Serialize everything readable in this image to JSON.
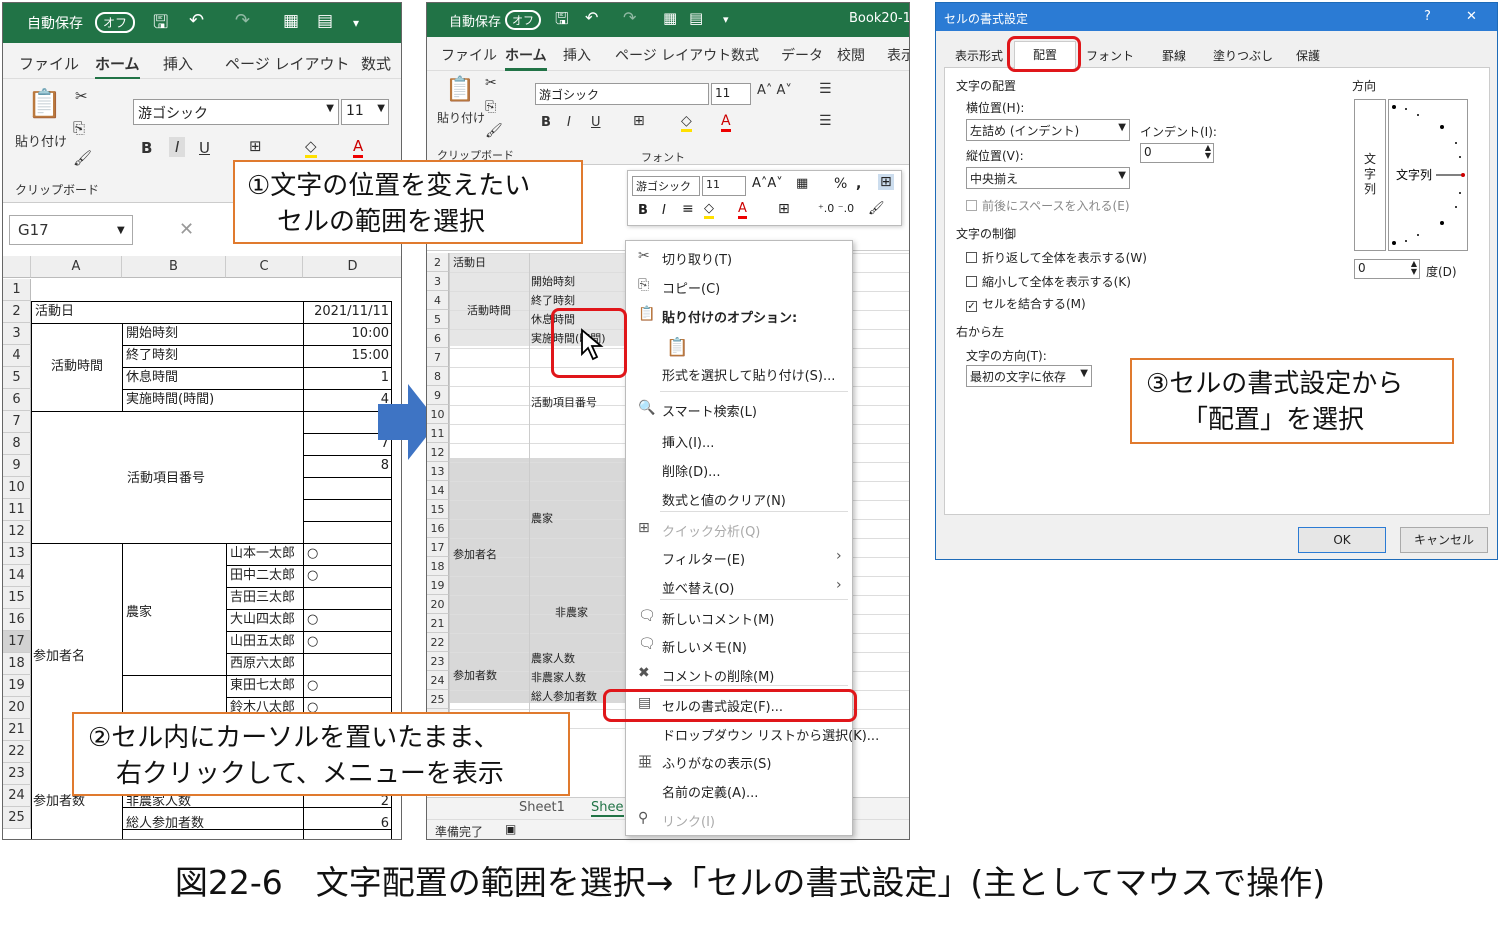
{
  "left_window": {
    "autosave": "自動保存",
    "toggle": "オフ",
    "menu": [
      "ファイル",
      "ホーム",
      "挿入",
      "ページ レイアウト",
      "数式"
    ],
    "paste": "貼り付け",
    "font_name": "游ゴシック",
    "font_size": "11",
    "bold": "B",
    "italic": "I",
    "underline": "U",
    "clipboard_group": "クリップボード",
    "name_box": "G17",
    "columns": [
      "A",
      "B",
      "C",
      "D"
    ],
    "rows": [
      "1",
      "2",
      "3",
      "4",
      "5",
      "6",
      "7",
      "8",
      "9",
      "10",
      "11",
      "12",
      "13",
      "14",
      "15",
      "16",
      "17",
      "18",
      "19",
      "20",
      "21",
      "22",
      "23",
      "24",
      "25"
    ],
    "cells": {
      "activity_day": "活動日",
      "date": "2021/11/11",
      "start": "開始時刻",
      "start_val": "10:00",
      "end": "終了時刻",
      "end_val": "15:00",
      "rest": "休息時間",
      "rest_val": "1",
      "duration": "実施時間(時間)",
      "duration_val": "4",
      "activity_time": "活動時間",
      "activity_item": "活動項目番号",
      "v7": "7",
      "v8": "8",
      "participants": "参加者名",
      "farmer": "農家",
      "names": [
        "山本一太郎",
        "田中二太郎",
        "吉田三太郎",
        "大山四太郎",
        "山田五太郎",
        "西原六太郎",
        "東田七太郎",
        "鈴木八太郎"
      ],
      "marks": [
        "○",
        "○",
        "",
        "○",
        "○",
        "",
        "○",
        "○"
      ],
      "participant_count": "参加者数",
      "non_farmer_count": "非農家人数",
      "non_farmer_val": "2",
      "total": "総人参加者数",
      "total_val": "6"
    }
  },
  "middle_window": {
    "autosave": "自動保存",
    "toggle": "オフ",
    "book": "Book20-1",
    "menu": [
      "ファイル",
      "ホーム",
      "挿入",
      "ページ レイアウト",
      "数式",
      "データ",
      "校閲",
      "表示"
    ],
    "font_name": "游ゴシック",
    "font_size": "11",
    "paste": "貼り付け",
    "clipboard_group": "クリップボード",
    "font_group": "フォント",
    "rows": [
      "2",
      "3",
      "4",
      "5",
      "6",
      "7",
      "8",
      "9",
      "10",
      "11",
      "12",
      "13",
      "14",
      "15",
      "16",
      "17",
      "18",
      "19",
      "20",
      "21",
      "22",
      "23",
      "24",
      "25",
      "26"
    ],
    "cells": {
      "activity_day": "活動日",
      "start": "開始時刻",
      "end": "終了時刻",
      "rest": "休息時間",
      "duration": "実施時間(時間)",
      "activity_time": "活動時間",
      "activity_item": "活動項目番号",
      "farmer": "農家",
      "non_farmer": "非農家",
      "participants": "参加者名",
      "participant_count": "参加者数",
      "farmer_count": "農家人数",
      "non_farmer_count": "非農家人数",
      "total": "総人参加者数"
    },
    "sheets": [
      "Sheet1",
      "Shee"
    ],
    "status": "準備完了"
  },
  "mini_toolbar": {
    "font_name": "游ゴシック",
    "font_size": "11"
  },
  "context_menu": [
    "切り取り(T)",
    "コピー(C)",
    "貼り付けのオプション:",
    "形式を選択して貼り付け(S)...",
    "スマート検索(L)",
    "挿入(I)...",
    "削除(D)...",
    "数式と値のクリア(N)",
    "クイック分析(Q)",
    "フィルター(E)",
    "並べ替え(O)",
    "新しいコメント(M)",
    "新しいメモ(N)",
    "コメントの削除(M)",
    "セルの書式設定(F)...",
    "ドロップダウン リストから選択(K)...",
    "ふりがなの表示(S)",
    "名前の定義(A)...",
    "リンク(I)"
  ],
  "dialog": {
    "title": "セルの書式設定",
    "help": "?",
    "close": "✕",
    "tabs": [
      "表示形式",
      "配置",
      "フォント",
      "罫線",
      "塗りつぶし",
      "保護"
    ],
    "text_alignment": "文字の配置",
    "horizontal_label": "横位置(H):",
    "horizontal_value": "左詰め (インデント)",
    "indent_label": "インデント(I):",
    "indent_value": "0",
    "vertical_label": "縦位置(V):",
    "vertical_value": "中央揃え",
    "justify_distributed": "前後にスペースを入れる(E)",
    "text_control": "文字の制御",
    "wrap": "折り返して全体を表示する(W)",
    "shrink": "縮小して全体を表示する(K)",
    "merge": "セルを結合する(M)",
    "rtl": "右から左",
    "direction_label": "文字の方向(T):",
    "direction_value": "最初の文字に依存",
    "orientation": "方向",
    "vertical_text": "文字列",
    "orient_text": "文字列",
    "degree_value": "0",
    "degree_label": "度(D)",
    "ok": "OK",
    "cancel": "キャンセル"
  },
  "callouts": {
    "c1_line1": "①文字の位置を変えたい",
    "c1_line2": "セルの範囲を選択",
    "c2_line1": "②セル内にカーソルを置いたまま、",
    "c2_line2": "右クリックして、メニューを表示",
    "c3_line1": "③セルの書式設定から",
    "c3_line2": "「配置」を選択"
  },
  "caption": "図22-6　文字配置の範囲を選択→「セルの書式設定」(主としてマウスで操作)",
  "colors": {
    "excel_green": "#217346",
    "callout_border": "#e07a2e",
    "highlight_red": "#e0161a",
    "arrow_blue": "#3e74c4"
  }
}
